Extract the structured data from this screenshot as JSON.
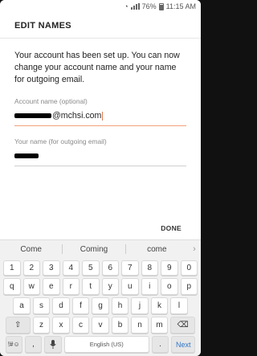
{
  "status_bar": {
    "battery": "76%",
    "time": "11:15 AM"
  },
  "header": {
    "title": "EDIT NAMES"
  },
  "main": {
    "message": "Your account has been set up. You can now change your account name and your name for outgoing email.",
    "account_name": {
      "label": "Account name (optional)",
      "value_visible": "@mchsi.com"
    },
    "your_name": {
      "label": "Your name (for outgoing email)"
    },
    "done_label": "DONE"
  },
  "keyboard": {
    "suggestions": [
      "Come",
      "Coming",
      "come"
    ],
    "row_numbers": [
      "1",
      "2",
      "3",
      "4",
      "5",
      "6",
      "7",
      "8",
      "9",
      "0"
    ],
    "row1": [
      "q",
      "w",
      "e",
      "r",
      "t",
      "y",
      "u",
      "i",
      "o",
      "p"
    ],
    "row2": [
      "a",
      "s",
      "d",
      "f",
      "g",
      "h",
      "j",
      "k",
      "l"
    ],
    "row3": [
      "z",
      "x",
      "c",
      "v",
      "b",
      "n",
      "m"
    ],
    "symbols_label": "!#☺",
    "comma": ",",
    "space_label": "English (US)",
    "period": ".",
    "next_label": "Next"
  }
}
